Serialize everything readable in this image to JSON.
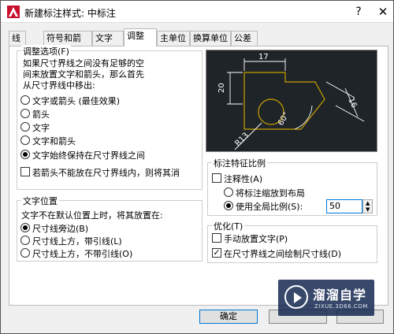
{
  "window": {
    "title": "新建标注样式: 中标注",
    "help_glyph": "?",
    "close_glyph": "✕"
  },
  "tabs": [
    {
      "label": "线",
      "active": false
    },
    {
      "label": "符号和箭头",
      "active": false
    },
    {
      "label": "文字",
      "active": false
    },
    {
      "label": "调整",
      "active": true
    },
    {
      "label": "主单位",
      "active": false
    },
    {
      "label": "换算单位",
      "active": false
    },
    {
      "label": "公差",
      "active": false
    }
  ],
  "fit_options": {
    "title": "调整选项(F)",
    "description": [
      "如果尺寸界线之间没有足够的空",
      "间来放置文字和箭头，那么首先",
      "从尺寸界线中移出:"
    ],
    "radios": [
      {
        "label": "文字或箭头 (最佳效果)",
        "checked": false
      },
      {
        "label": "箭头",
        "checked": false
      },
      {
        "label": "文字",
        "checked": false
      },
      {
        "label": "文字和箭头",
        "checked": false
      },
      {
        "label": "文字始终保持在尺寸界线之间",
        "checked": true
      }
    ],
    "suppress_arrows": {
      "label": "若箭头不能放在尺寸界线内，则将其消",
      "checked": false
    }
  },
  "text_placement": {
    "title": "文字位置",
    "description": "文字不在默认位置上时，将其放置在:",
    "radios": [
      {
        "label": "尺寸线旁边(B)",
        "checked": true
      },
      {
        "label": "尺寸线上方，带引线(L)",
        "checked": false
      },
      {
        "label": "尺寸线上方，不带引线(O)",
        "checked": false
      }
    ]
  },
  "preview": {
    "dim_17": "17",
    "dim_20": "20",
    "dim_angle": "60°",
    "dim_radius": "R13",
    "dim_diag": "16",
    "line_color": "#c8a000",
    "dim_color": "#ffffff"
  },
  "scale": {
    "title": "标注特征比例",
    "annotative": {
      "label": "注释性(A)",
      "checked": false
    },
    "radios": [
      {
        "label": "将标注缩放到布局",
        "checked": false
      },
      {
        "label": "使用全局比例(S):",
        "checked": true
      }
    ],
    "global_scale_value": "50"
  },
  "fine_tuning": {
    "title": "优化(T)",
    "checks": [
      {
        "label": "手动放置文字(P)",
        "checked": false
      },
      {
        "label": "在尺寸界线之间绘制尺寸线(D)",
        "checked": true
      }
    ]
  },
  "buttons": {
    "ok": "确定"
  },
  "watermark": {
    "title": "溜溜自学",
    "subtitle": "ZIXUE.3D66.COM"
  }
}
